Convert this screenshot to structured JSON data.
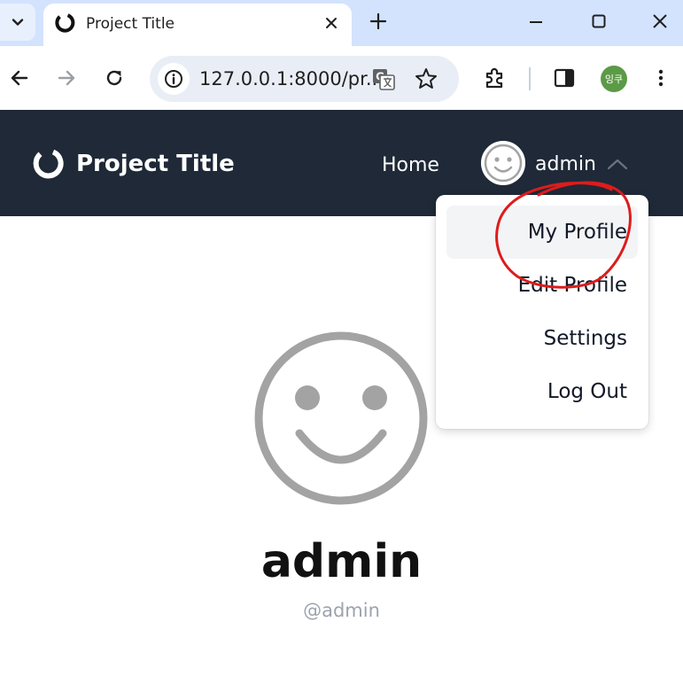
{
  "browser": {
    "tab": {
      "title": "Project Title"
    },
    "omnibox": {
      "url": "127.0.0.1:8000/pr..."
    },
    "profile_initials": "잉쿠",
    "colors": {
      "tabstrip": "#d3e3fd",
      "omnibox": "#e9eef6",
      "profile": "#5b9a46"
    },
    "icons": [
      "chevron-down-icon",
      "close-icon",
      "plus-icon",
      "minimize-icon",
      "maximize-icon",
      "back-arrow-icon",
      "forward-arrow-icon",
      "reload-icon",
      "info-icon",
      "translate-icon",
      "star-icon",
      "extensions-icon",
      "side-panel-icon",
      "more-vert-icon"
    ]
  },
  "navbar": {
    "brand": "Project Title",
    "home": "Home",
    "username": "admin",
    "color": "#1f2937"
  },
  "menu": {
    "items": [
      {
        "label": "My Profile",
        "active": true
      },
      {
        "label": "Edit Profile",
        "active": false
      },
      {
        "label": "Settings",
        "active": false
      },
      {
        "label": "Log Out",
        "active": false
      }
    ]
  },
  "profile": {
    "name": "admin",
    "handle": "@admin",
    "avatar_icon": "smiley-face-icon"
  },
  "annotation": {
    "type": "red-hand-drawn-circle",
    "target": "My Profile",
    "color": "#dd1c1c"
  }
}
